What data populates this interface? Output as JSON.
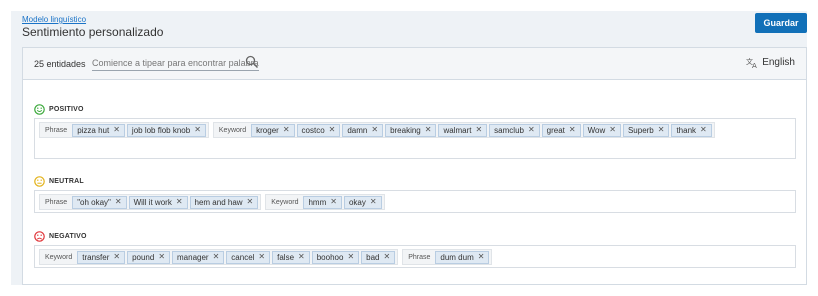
{
  "header": {
    "breadcrumb": "Modelo linguístico",
    "title": "Sentimiento personalizado",
    "save_label": "Guardar"
  },
  "toolbar": {
    "entity_count": "25 entidades",
    "search_placeholder": "Comience a tipear para encontrar palabras",
    "language": "English"
  },
  "sections": {
    "positive": {
      "label": "POSITIVO",
      "color": "#3aa83a",
      "phrase_label": "Phrase",
      "phrases": [
        "pizza hut",
        "job lob flob knob"
      ],
      "keyword_label": "Keyword",
      "keywords": [
        "kroger",
        "costco",
        "damn",
        "breaking",
        "walmart",
        "samclub",
        "great",
        "Wow",
        "Superb",
        "thank"
      ]
    },
    "neutral": {
      "label": "NEUTRAL",
      "color": "#e3b21a",
      "phrase_label": "Phrase",
      "phrases": [
        "\"oh okay\"",
        "Will it work",
        "hem and haw"
      ],
      "keyword_label": "Keyword",
      "keywords": [
        "hmm",
        "okay"
      ]
    },
    "negative": {
      "label": "NEGATIVO",
      "color": "#e0363a",
      "keyword_label": "Keyword",
      "keywords": [
        "transfer",
        "pound",
        "manager",
        "cancel",
        "false",
        "boohoo",
        "bad"
      ],
      "phrase_label": "Phrase",
      "phrases": [
        "dum dum"
      ]
    }
  },
  "icons": {
    "search": "search-icon",
    "language": "translate-icon",
    "remove": "close-icon",
    "positive": "smile-icon",
    "neutral": "neutral-face-icon",
    "negative": "frown-icon"
  },
  "colors": {
    "accent": "#1170b8",
    "tag_bg": "#dfe9f3",
    "tag_border": "#b9cde2"
  }
}
